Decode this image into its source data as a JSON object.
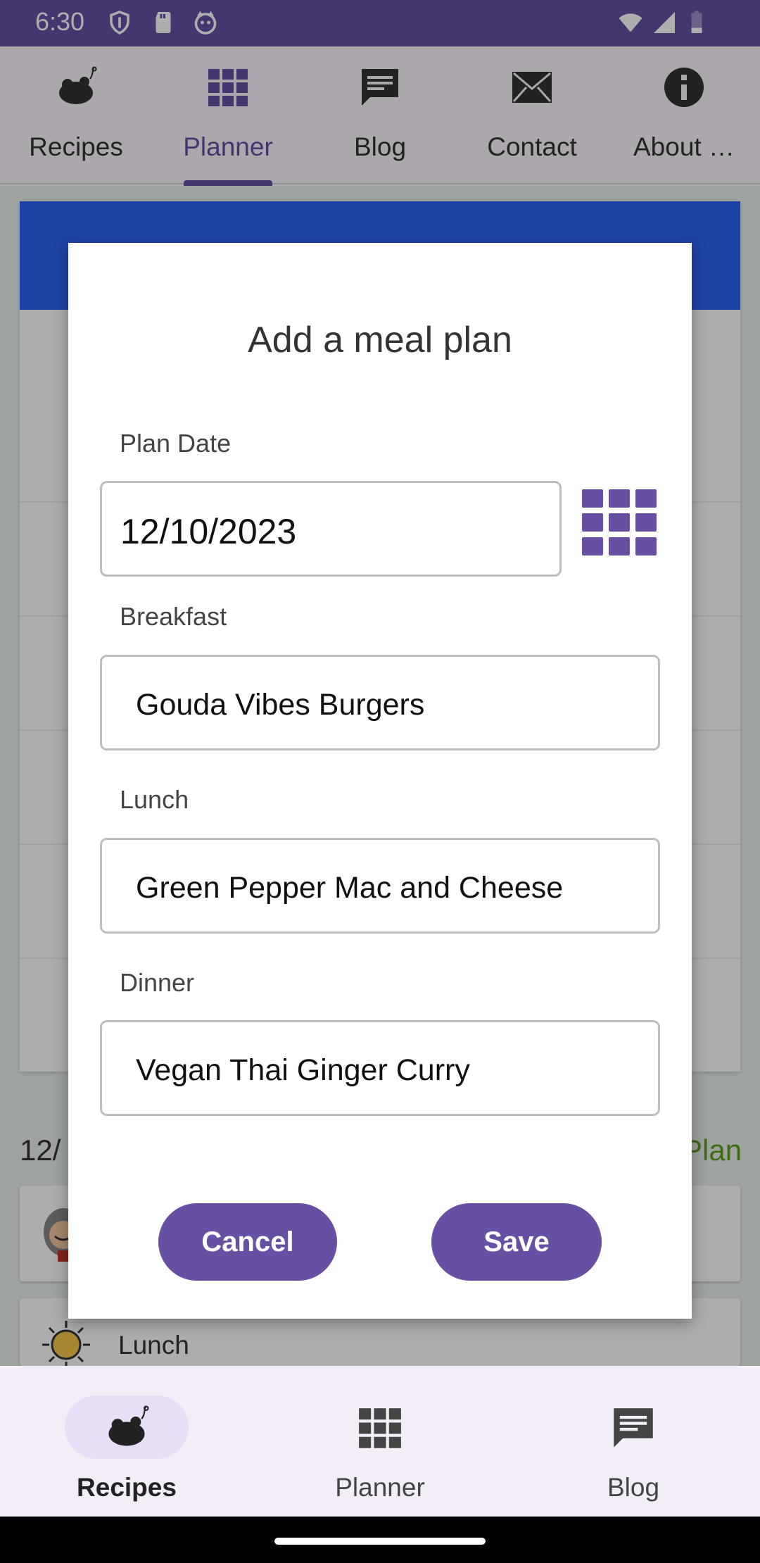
{
  "status_bar": {
    "time": "6:30"
  },
  "top_tabs": [
    {
      "label": "Recipes",
      "icon": "chicken-icon"
    },
    {
      "label": "Planner",
      "icon": "grid-icon",
      "active": true
    },
    {
      "label": "Blog",
      "icon": "chat-icon"
    },
    {
      "label": "Contact",
      "icon": "mail-icon"
    },
    {
      "label": "About …",
      "icon": "info-icon"
    }
  ],
  "background": {
    "plan_date": "12/",
    "plan_link": "Plan",
    "lunch_label": "Lunch"
  },
  "dialog": {
    "title": "Add a meal plan",
    "plan_date_label": "Plan Date",
    "plan_date_value": "12/10/2023",
    "breakfast_label": "Breakfast",
    "breakfast_value": "Gouda Vibes Burgers",
    "lunch_label": "Lunch",
    "lunch_value": "Green Pepper Mac and Cheese",
    "dinner_label": "Dinner",
    "dinner_value": "Vegan Thai Ginger Curry",
    "cancel_label": "Cancel",
    "save_label": "Save"
  },
  "bottom_nav": [
    {
      "label": "Recipes",
      "icon": "chicken-icon",
      "active": true
    },
    {
      "label": "Planner",
      "icon": "grid-icon"
    },
    {
      "label": "Blog",
      "icon": "chat-icon"
    }
  ],
  "colors": {
    "primary": "#6750a4",
    "calendar_header": "#2b64f5",
    "accent_green": "#5aa020",
    "today_orange": "#e8891a"
  }
}
